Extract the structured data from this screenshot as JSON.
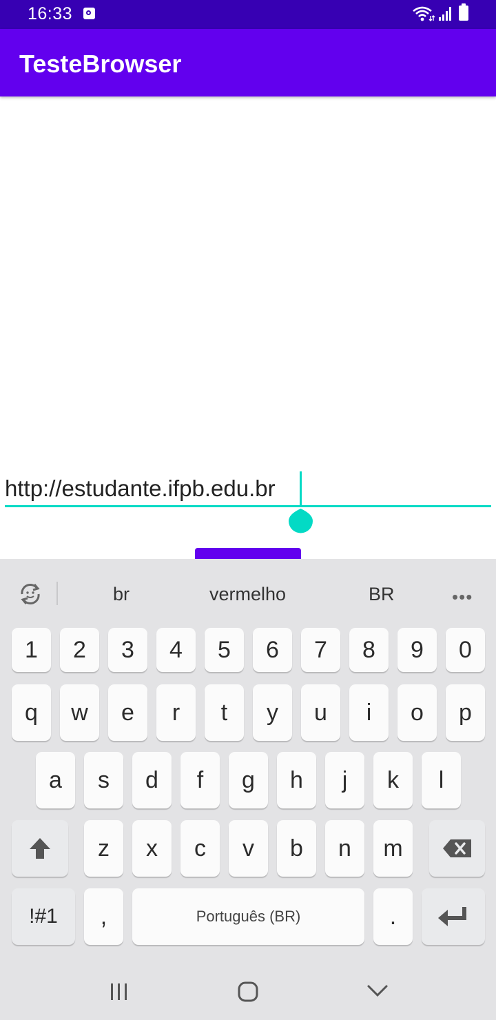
{
  "status_bar": {
    "time": "16:33"
  },
  "app_bar": {
    "title": "TesteBrowser"
  },
  "url_input": {
    "value": "http://estudante.ifpb.edu.br"
  },
  "keyboard": {
    "suggestions": [
      "br",
      "vermelho",
      "BR"
    ],
    "more_label": "•••",
    "number_row": [
      "1",
      "2",
      "3",
      "4",
      "5",
      "6",
      "7",
      "8",
      "9",
      "0"
    ],
    "row1": [
      "q",
      "w",
      "e",
      "r",
      "t",
      "y",
      "u",
      "i",
      "o",
      "p"
    ],
    "row2": [
      "a",
      "s",
      "d",
      "f",
      "g",
      "h",
      "j",
      "k",
      "l"
    ],
    "row3": [
      "z",
      "x",
      "c",
      "v",
      "b",
      "n",
      "m"
    ],
    "symbols_label": "!#1",
    "comma_label": ",",
    "space_label": "Português (BR)",
    "period_label": "."
  },
  "colors": {
    "status_bar": "#3700b3",
    "app_bar": "#6200ee",
    "accent": "#03dac5",
    "keyboard_bg": "#e3e3e5"
  },
  "icons": {
    "status_bar": [
      "notification-icon",
      "wifi-icon",
      "signal-icon",
      "battery-icon"
    ],
    "keyboard": [
      "refresh-icon",
      "shift-icon",
      "backspace-icon",
      "enter-icon"
    ],
    "nav_bar": [
      "recents-icon",
      "home-icon",
      "back-icon"
    ]
  }
}
